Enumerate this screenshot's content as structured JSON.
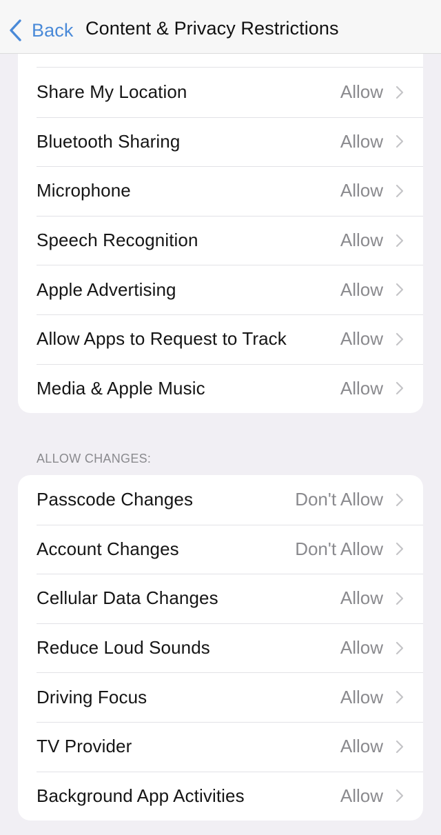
{
  "navbar": {
    "back_label": "Back",
    "title": "Content & Privacy Restrictions",
    "accent_color": "#4a8ad8"
  },
  "privacy_group": {
    "items": [
      {
        "label": "Share My Location",
        "value": "Allow"
      },
      {
        "label": "Bluetooth Sharing",
        "value": "Allow"
      },
      {
        "label": "Microphone",
        "value": "Allow"
      },
      {
        "label": "Speech Recognition",
        "value": "Allow"
      },
      {
        "label": "Apple Advertising",
        "value": "Allow"
      },
      {
        "label": "Allow Apps to Request to Track",
        "value": "Allow"
      },
      {
        "label": "Media & Apple Music",
        "value": "Allow"
      }
    ]
  },
  "allow_changes": {
    "header": "ALLOW CHANGES:",
    "items": [
      {
        "label": "Passcode Changes",
        "value": "Don't Allow"
      },
      {
        "label": "Account Changes",
        "value": "Don't Allow"
      },
      {
        "label": "Cellular Data Changes",
        "value": "Allow"
      },
      {
        "label": "Reduce Loud Sounds",
        "value": "Allow"
      },
      {
        "label": "Driving Focus",
        "value": "Allow"
      },
      {
        "label": "TV Provider",
        "value": "Allow"
      },
      {
        "label": "Background App Activities",
        "value": "Allow"
      }
    ]
  }
}
